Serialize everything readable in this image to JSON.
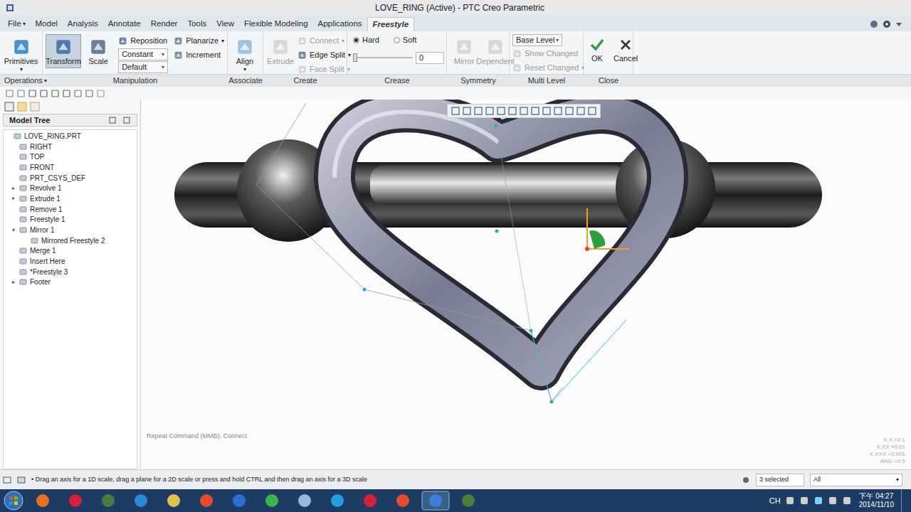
{
  "window": {
    "title": "LOVE_RING (Active) - PTC Creo Parametric"
  },
  "tabs": [
    {
      "label": "File",
      "arrow": "▾",
      "selected": false
    },
    {
      "label": "Model",
      "selected": false
    },
    {
      "label": "Analysis",
      "selected": false
    },
    {
      "label": "Annotate",
      "selected": false
    },
    {
      "label": "Render",
      "selected": false
    },
    {
      "label": "Tools",
      "selected": false
    },
    {
      "label": "View",
      "selected": false
    },
    {
      "label": "Flexible Modeling",
      "selected": false
    },
    {
      "label": "Applications",
      "selected": false
    },
    {
      "label": "Freestyle",
      "selected": true
    }
  ],
  "ribbon": {
    "operations": {
      "label": "Operations",
      "arrow": "▾",
      "primitives": {
        "label": "Primitives",
        "arrow": "▾"
      }
    },
    "manipulation": {
      "label": "Manipulation",
      "transform": {
        "label": "Transform",
        "selected": true
      },
      "scale": {
        "label": "Scale",
        "selected": false
      },
      "reposition": {
        "label": "Reposition"
      },
      "planarize": {
        "label": "Planarize",
        "arrow": "▾"
      },
      "constant": {
        "value": "Constant",
        "arrow": "▾"
      },
      "default": {
        "value": "Default",
        "arrow": "▾"
      },
      "increment": {
        "label": "Increment"
      }
    },
    "associate": {
      "label": "Associate",
      "align": {
        "label": "Align",
        "arrow": "▾"
      }
    },
    "create": {
      "label": "Create",
      "extrude": {
        "label": "Extrude",
        "disabled": true
      },
      "connect": {
        "label": "Connect",
        "arrow": "▾",
        "disabled": true
      },
      "edge_split": {
        "label": "Edge Split",
        "arrow": "▾",
        "disabled": false
      },
      "face_split": {
        "label": "Face Split",
        "arrow": "▾",
        "disabled": true
      }
    },
    "crease": {
      "label": "Crease",
      "options": [
        {
          "label": "Hard",
          "selected": true
        },
        {
          "label": "Soft",
          "selected": false
        }
      ],
      "slider": {
        "level": 0,
        "value": "0"
      }
    },
    "symmetry": {
      "label": "Symmetry",
      "mirror": {
        "label": "Mirror",
        "disabled": true
      },
      "dependent": {
        "label": "Dependent",
        "disabled": true
      }
    },
    "multi_level": {
      "label": "Multi Level",
      "level_select": {
        "value": "Base Level",
        "arrow": "▾"
      },
      "show_changed": {
        "label": "Show Changed",
        "disabled": true
      },
      "reset_changed": {
        "label": "Reset Changed",
        "arrow": "▾",
        "disabled": true
      }
    },
    "close": {
      "label": "Close",
      "ok": {
        "label": "OK"
      },
      "cancel": {
        "label": "Cancel"
      }
    }
  },
  "model_tree": {
    "title": "Model Tree",
    "root": {
      "label": "LOVE_RING.PRT",
      "children": [
        {
          "label": "RIGHT"
        },
        {
          "label": "TOP"
        },
        {
          "label": "FRONT"
        },
        {
          "label": "PRT_CSYS_DEF"
        },
        {
          "label": "Revolve 1",
          "toggle": "▸",
          "expanded": false
        },
        {
          "label": "Extrude 1",
          "toggle": "▸",
          "expanded": false
        },
        {
          "label": "Remove 1"
        },
        {
          "label": "Freestyle 1"
        },
        {
          "label": "Mirror 1",
          "toggle": "▾",
          "expanded": true,
          "children": [
            {
              "label": "Mirrored Freestyle 2"
            }
          ]
        },
        {
          "label": "Merge 1"
        },
        {
          "label": "Insert Here"
        },
        {
          "label": "*Freestyle 3"
        },
        {
          "label": "Footer",
          "toggle": "▸",
          "expanded": false
        }
      ]
    }
  },
  "graphics": {
    "hint": "Repeat Command (MMB): Connect",
    "readouts": [
      "X.X =0.1",
      "X.XX =0.01",
      "X.XXX =0.001",
      "ANG =0.5"
    ]
  },
  "status_bar": {
    "bullet": "•",
    "message": "Drag an axis for a 1D scale, drag a plane for a 2D scale or press and hold CTRL and then drag an axis for a 3D scale",
    "selection": "3 selected",
    "filter": {
      "value": "All",
      "arrow": "▾"
    }
  },
  "taskbar": {
    "language": "CH",
    "time": "下午 04:27",
    "date": "2014/11/10"
  }
}
